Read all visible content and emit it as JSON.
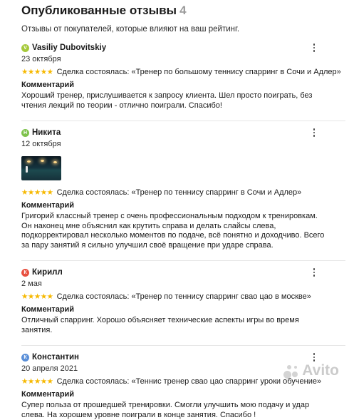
{
  "header": {
    "title": "Опубликованные отзывы",
    "count": "4",
    "subtitle": "Отзывы от покупателей, которые влияют на ваш рейтинг."
  },
  "comment_label": "Комментарий",
  "stars": "★★★★★",
  "more_icon": "kebab-menu-icon",
  "star_color": "#f6b800",
  "reviews": [
    {
      "initial": "V",
      "avatar_color": "#a6c93b",
      "author": "Vasiliy Dubovitskiy",
      "date": "23 октября",
      "deal": "Сделка состоялась: «Тренер по большому теннису спарринг в Сочи и Адлер»",
      "comment": "Хороший тренер, прислушивается к запросу клиента. Шел просто поиграть, без чтения лекций по теории - отлично поиграли. Спасибо!"
    },
    {
      "initial": "Н",
      "avatar_color": "#7ec24c",
      "author": "Никита",
      "date": "12 октября",
      "deal": "Сделка состоялась: «Тренер по теннису спарринг в Сочи и Адлер»",
      "comment": "Григорий классный тренер с очень профессиональным подходом к тренировкам. Он наконец мне объяснил как крутить справа и делать слайсы слева, подкорректировал несколько моментов по подаче, всё понятно и доходчиво. Всего за пару занятий я сильно улучшил своё вращение при ударе справа."
    },
    {
      "initial": "К",
      "avatar_color": "#e8503f",
      "author": "Кирилл",
      "date": "2 мая",
      "deal": "Сделка состоялась: «Тренер по теннису спарринг свао цао в москве»",
      "comment": "Отличный спарринг. Хорошо объясняет технические аспекты игры во время занятия."
    },
    {
      "initial": "К",
      "avatar_color": "#5a8fd8",
      "author": "Константин",
      "date": "20 апреля 2021",
      "deal": "Сделка состоялась: «Теннис тренер свао цао спарринг уроки обучение»",
      "comment": "Супер польза от прошедшей тренировки. Смогли улучшить мою подачу и удар слева. На хорошем уровне поиграли в конце занятия. Спасибо !"
    }
  ],
  "watermark": "Avito"
}
